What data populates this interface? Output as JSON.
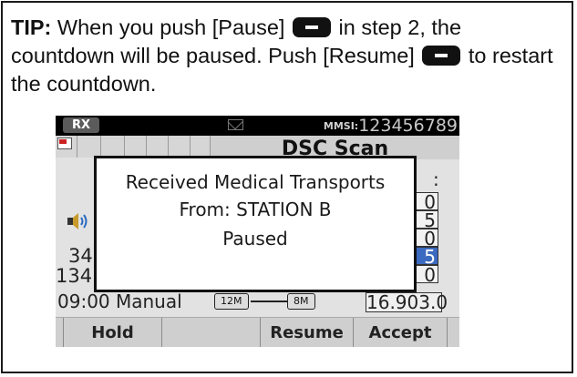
{
  "tip": {
    "label": "TIP:",
    "text_1": " When you push [Pause] ",
    "text_2": " in step 2, the countdown will be paused. Push [Resume] ",
    "text_3": " to restart the countdown."
  },
  "radio": {
    "status": {
      "rx_label": "RX",
      "mmsi_label": "MMSI:",
      "mmsi_value": "123456789"
    },
    "title": "DSC Scan",
    "background": {
      "colon": ":",
      "left_num_1": "34",
      "left_num_2": "134",
      "channels": [
        {
          "text": "0",
          "selected": false
        },
        {
          "text": "5",
          "selected": false
        },
        {
          "text": "0",
          "selected": false
        },
        {
          "text": "5",
          "selected": true
        },
        {
          "text": "0",
          "selected": false
        }
      ]
    },
    "statusline": {
      "time_mode": "09:00 Manual",
      "range_left": "12M",
      "range_right": "8M",
      "frequency": "16.903.0"
    },
    "popup": {
      "line_1": "Received Medical Transports",
      "line_2": "From: STATION B",
      "line_3": "Paused"
    },
    "softkeys": [
      "Hold",
      "",
      "Resume",
      "Accept"
    ]
  },
  "colors": {
    "lcd_bg": "#e2e2e2",
    "selected_channel": "#3c6ac0",
    "status_bar": "#000000"
  },
  "icons": [
    "envelope-icon",
    "speaker-icon",
    "dsc-message-icon",
    "minus-key-icon"
  ]
}
